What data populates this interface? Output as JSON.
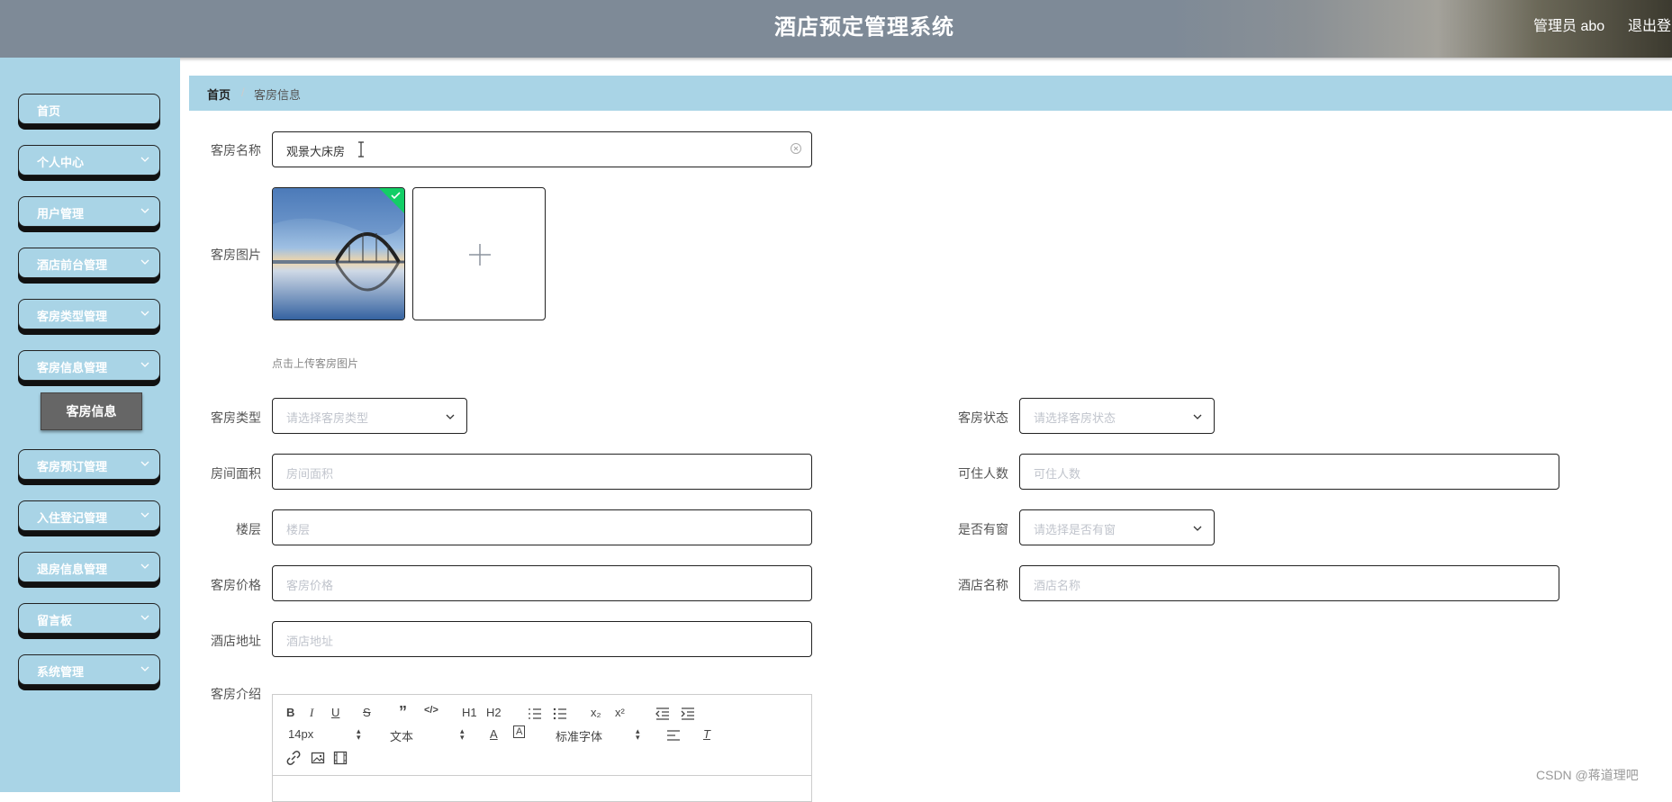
{
  "header": {
    "title": "酒店预定管理系统",
    "user": "管理员 abo",
    "logout": "退出登录"
  },
  "sidebar": {
    "items": [
      {
        "label": "首页"
      },
      {
        "label": "个人中心"
      },
      {
        "label": "用户管理"
      },
      {
        "label": "酒店前台管理"
      },
      {
        "label": "客房类型管理"
      },
      {
        "label": "客房信息管理"
      },
      {
        "label": "客房预订管理"
      },
      {
        "label": "入住登记管理"
      },
      {
        "label": "退房信息管理"
      },
      {
        "label": "留言板"
      },
      {
        "label": "系统管理"
      }
    ],
    "submenu_active": "客房信息"
  },
  "breadcrumb": {
    "home": "首页",
    "separator": "/",
    "current": "客房信息"
  },
  "form": {
    "room_name": {
      "label": "客房名称",
      "value": "观景大床房"
    },
    "room_image": {
      "label": "客房图片",
      "hint": "点击上传客房图片"
    },
    "room_type": {
      "label": "客房类型",
      "placeholder": "请选择客房类型"
    },
    "room_status": {
      "label": "客房状态",
      "placeholder": "请选择客房状态"
    },
    "room_area": {
      "label": "房间面积",
      "placeholder": "房间面积"
    },
    "capacity": {
      "label": "可住人数",
      "placeholder": "可住人数"
    },
    "floor": {
      "label": "楼层",
      "placeholder": "楼层"
    },
    "has_window": {
      "label": "是否有窗",
      "placeholder": "请选择是否有窗"
    },
    "room_price": {
      "label": "客房价格",
      "placeholder": "客房价格"
    },
    "hotel_name": {
      "label": "酒店名称",
      "placeholder": "酒店名称"
    },
    "hotel_address": {
      "label": "酒店地址",
      "placeholder": "酒店地址"
    },
    "room_intro": {
      "label": "客房介绍"
    }
  },
  "editor": {
    "font_size": "14px",
    "text_style": "文本",
    "font_family": "标准字体",
    "h1": "H1",
    "h2": "H2",
    "sub": "x₂",
    "sup": "x²"
  },
  "watermark": "CSDN @蒋道理吧",
  "colors": {
    "sidebar_bg": "#a9d4e6",
    "header_bg": "#7e8a97",
    "active_sub": "#666666",
    "upload_check": "#13ce66"
  }
}
